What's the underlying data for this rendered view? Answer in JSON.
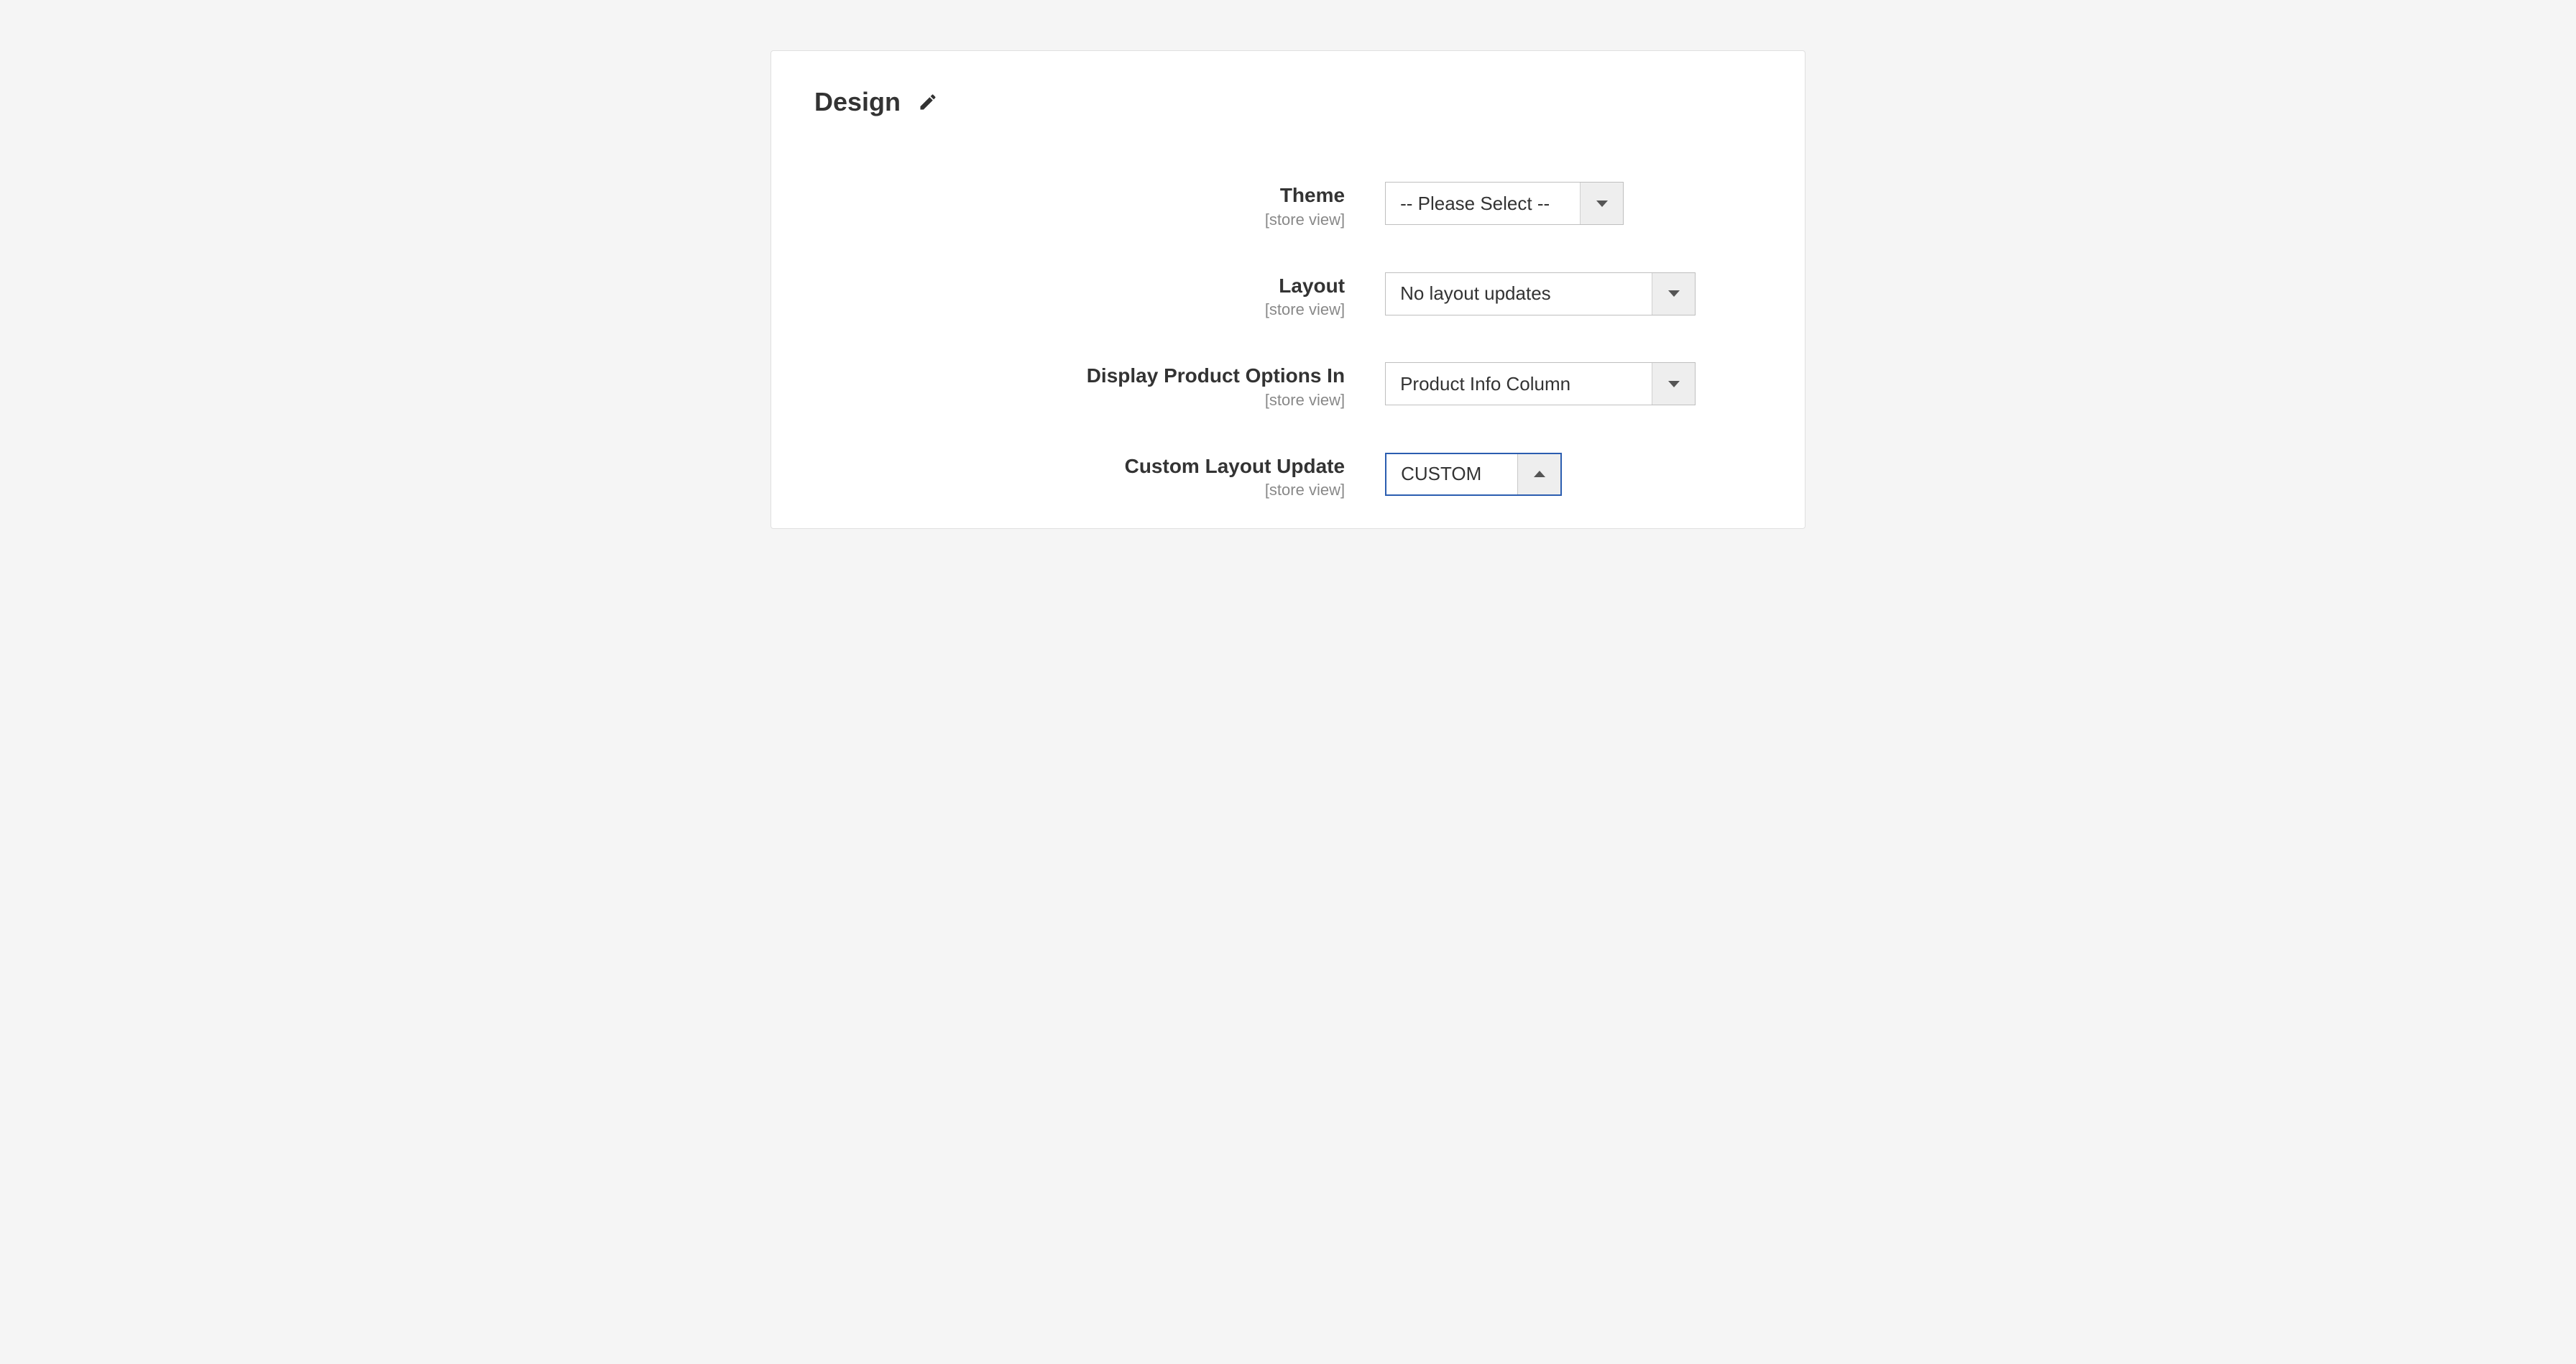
{
  "section": {
    "title": "Design"
  },
  "fields": {
    "theme": {
      "label": "Theme",
      "scope": "[store view]",
      "value": "-- Please Select --"
    },
    "layout": {
      "label": "Layout",
      "scope": "[store view]",
      "value": "No layout updates"
    },
    "display_options": {
      "label": "Display Product Options In",
      "scope": "[store view]",
      "value": "Product Info Column"
    },
    "custom_layout_update": {
      "label": "Custom Layout Update",
      "scope": "[store view]",
      "value": "CUSTOM"
    }
  }
}
